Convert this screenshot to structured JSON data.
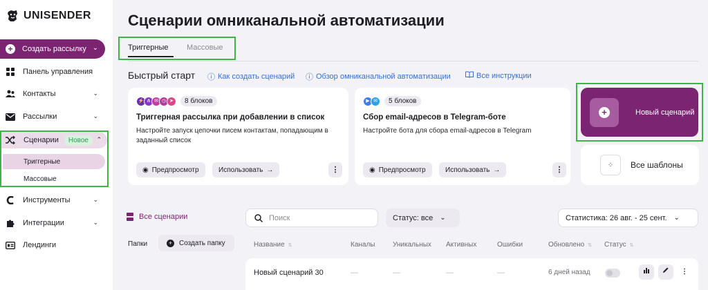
{
  "brand": {
    "name": "UNISENDER",
    "accent": "#7b2572",
    "highlight_border": "#3db34a",
    "link_color": "#3b6fc9"
  },
  "sidebar": {
    "create_button": "Создать рассылку",
    "items": [
      {
        "label": "Панель управления",
        "icon": "dashboard-icon"
      },
      {
        "label": "Контакты",
        "icon": "contacts-icon"
      },
      {
        "label": "Рассылки",
        "icon": "mail-icon"
      },
      {
        "label": "Сценарии",
        "icon": "shuffle-icon",
        "badge": "Новое"
      },
      {
        "label": "Инструменты",
        "icon": "tools-icon"
      },
      {
        "label": "Интеграции",
        "icon": "puzzle-icon"
      },
      {
        "label": "Лендинги",
        "icon": "landing-icon"
      }
    ],
    "sub_items": [
      "Триггерные",
      "Массовые"
    ]
  },
  "main": {
    "title": "Сценарии омниканальной автоматизации",
    "tabs": [
      "Триггерные",
      "Массовые"
    ],
    "quick_start": {
      "title": "Быстрый старт",
      "links": [
        "Как создать сценарий",
        "Обзор омниканальной автоматизации",
        "Все инструкции"
      ]
    },
    "cards": [
      {
        "blocks": "8 блоков",
        "title": "Триггерная рассылка при добавлении в список",
        "desc": "Настройте запуск цепочки писем контактам, попадающим в заданный список",
        "preview": "Предпросмотр",
        "use": "Использовать"
      },
      {
        "blocks": "5 блоков",
        "title": "Сбор email-адресов в Telegram-боте",
        "desc": "Настройте бота для сбора email-адресов в Telegram",
        "preview": "Предпросмотр",
        "use": "Использовать"
      }
    ],
    "new_scenario": "Новый сценарий",
    "all_templates": "Все шаблоны"
  },
  "list": {
    "all_scenarios": "Все сценарии",
    "folders": "Папки",
    "create_folder": "Создать папку",
    "search_placeholder": "Поиск",
    "status_filter": "Статус: все",
    "stats_filter": "Статистика: 26 авг. - 25 сент.",
    "columns": [
      "Название",
      "Каналы",
      "Уникальных",
      "Активных",
      "Ошибки",
      "Обновлено",
      "Статус"
    ],
    "rows": [
      {
        "name": "Новый сценарий 30",
        "channels": "—",
        "unique": "—",
        "active": "—",
        "errors": "—",
        "updated": "6 дней назад"
      }
    ]
  }
}
